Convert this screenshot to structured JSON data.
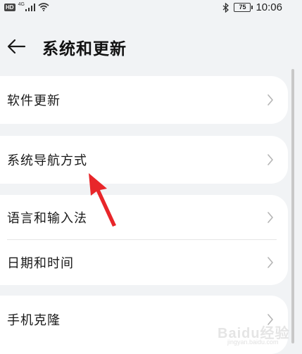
{
  "status_bar": {
    "badge": "HD",
    "network": "4G",
    "battery": "75",
    "time": "10:06"
  },
  "header": {
    "title": "系统和更新"
  },
  "groups": [
    {
      "items": [
        {
          "label": "软件更新"
        }
      ]
    },
    {
      "items": [
        {
          "label": "系统导航方式"
        }
      ]
    },
    {
      "items": [
        {
          "label": "语言和输入法"
        },
        {
          "label": "日期和时间"
        }
      ]
    },
    {
      "items": [
        {
          "label": "手机克隆"
        }
      ]
    }
  ],
  "annotation": {
    "color": "#e8262a"
  },
  "watermark": {
    "text": "Baidu经验",
    "subtext": "jingyan.baidu.com"
  },
  "colors": {
    "background": "#f1f3f5",
    "card": "#ffffff",
    "chevron": "#b5b5b5"
  }
}
